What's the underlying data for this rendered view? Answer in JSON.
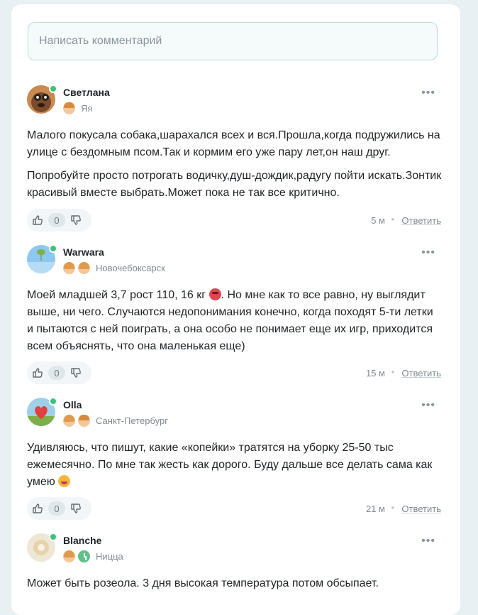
{
  "comment_input": {
    "placeholder": "Написать комментарий"
  },
  "comments": [
    {
      "author": "Светлана",
      "kids_label": "Яя",
      "location": "",
      "paragraphs": [
        "Малого покусала собака,шарахался всех и вся.Прошла,когда подружились на улице с бездомным псом.Так и кормим его уже пару лет,он наш друг.",
        "Попробуйте просто потрогать водичку,душ-дождик,радугу пойти искать.Зонтик красивый вместе выбрать.Может пока не так все критично."
      ],
      "votes": "0",
      "time": "5 м",
      "reply": "Ответить"
    },
    {
      "author": "Warwara",
      "kids_label": "",
      "location": "Новочебоксарск",
      "paragraphs": [
        "Моей младшей 3,7 рост 110, 16 кг",
        ". Но мне как то все равно, ну выглядит выше, ни чего. Случаются недопонимания конечно, когда походят 5-ти летки и пытаются с ней поиграть, а она особо не понимает еще их игр, приходится всем объяснять, что она маленькая еще)"
      ],
      "votes": "0",
      "time": "15 м",
      "reply": "Ответить"
    },
    {
      "author": "Olla",
      "kids_label": "",
      "location": "Санкт-Петербург",
      "paragraphs": [
        "Удивляюсь, что пишут, какие «копейки» тратятся на уборку 25-50 тыс ежемесячно. По мне так жесть как дорого. Буду дальше все делать сама как умею"
      ],
      "votes": "0",
      "time": "21 м",
      "reply": "Ответить"
    },
    {
      "author": "Blanche",
      "kids_label": "",
      "location": "Ницца",
      "paragraphs": [
        "Может быть розеола. 3 дня высокая температура потом обсыпает."
      ]
    }
  ],
  "colors": {
    "online": "#3fc17a",
    "accent_border": "#b9dbe3",
    "page_bg": "#e8f0f3"
  },
  "icons": [
    "more-dots-icon",
    "thumbs-up-icon",
    "thumbs-down-icon",
    "child-icon",
    "online-dot-icon"
  ]
}
